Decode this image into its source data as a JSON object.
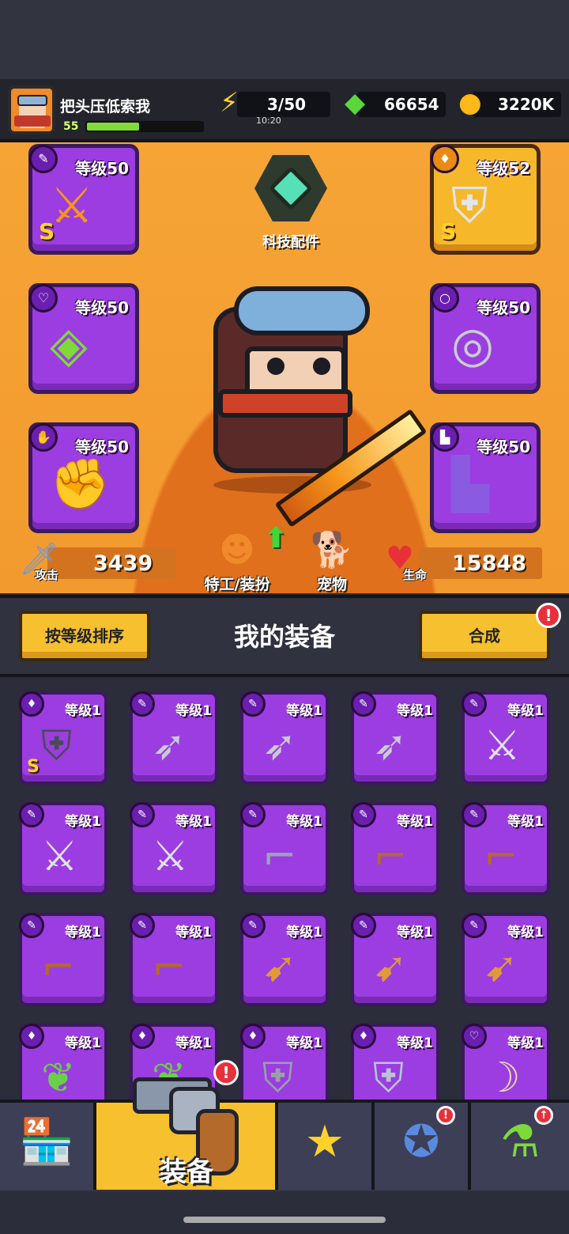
{
  "player": {
    "name": "把头压低索我",
    "level": "55",
    "xp_fraction": 0.45
  },
  "resources": {
    "energy": {
      "value": "3/50",
      "timer": "10:20",
      "icon": "lightning-icon"
    },
    "gems": {
      "value": "66654",
      "icon": "green-gem-icon"
    },
    "coins": {
      "value": "3220K",
      "icon": "gold-coin-icon"
    }
  },
  "equip_slots": {
    "weapon": {
      "level": "等级50",
      "rank": "S",
      "icon": "sword-icon"
    },
    "armor": {
      "level": "等级52",
      "rank": "S",
      "icon": "armor-icon"
    },
    "necklace": {
      "level": "等级50",
      "icon": "necklace-icon"
    },
    "ring": {
      "level": "等级50",
      "icon": "ring-icon"
    },
    "gloves": {
      "level": "等级50",
      "icon": "gauntlet-icon"
    },
    "boots": {
      "level": "等级50",
      "icon": "boot-icon"
    }
  },
  "tech_parts": {
    "label": "科技配件"
  },
  "stats": {
    "attack_label": "攻击",
    "attack": "3439",
    "hp_label": "生命",
    "hp": "15848"
  },
  "buttons": {
    "agent": "特工/装扮",
    "pet": "宠物",
    "sort": "按等级排序",
    "merge": "合成",
    "merge_alert": "!"
  },
  "panel_title": "我的装备",
  "inventory": [
    {
      "level": "等级1",
      "rank": "S",
      "icon": "dark-armor-icon"
    },
    {
      "level": "等级1",
      "icon": "kunai-icon"
    },
    {
      "level": "等级1",
      "icon": "kunai-icon"
    },
    {
      "level": "等级1",
      "icon": "kunai-icon"
    },
    {
      "level": "等级1",
      "icon": "katana-icon"
    },
    {
      "level": "等级1",
      "icon": "katana-icon"
    },
    {
      "level": "等级1",
      "icon": "katana-icon"
    },
    {
      "level": "等级1",
      "icon": "revolver-icon"
    },
    {
      "level": "等级1",
      "icon": "shotgun-icon"
    },
    {
      "level": "等级1",
      "icon": "shotgun-icon"
    },
    {
      "level": "等级1",
      "icon": "shotgun-icon"
    },
    {
      "level": "等级1",
      "icon": "shotgun-icon"
    },
    {
      "level": "等级1",
      "icon": "drill-icon"
    },
    {
      "level": "等级1",
      "icon": "drill-icon"
    },
    {
      "level": "等级1",
      "icon": "drill-icon"
    },
    {
      "level": "等级1",
      "icon": "leaf-armor-icon"
    },
    {
      "level": "等级1",
      "icon": "leaf-armor-icon"
    },
    {
      "level": "等级1",
      "icon": "stone-armor-icon"
    },
    {
      "level": "等级1",
      "icon": "knight-armor-icon"
    },
    {
      "level": "等级1",
      "icon": "fang-necklace-icon"
    }
  ],
  "bottom_nav": {
    "shop": {
      "icon": "shop-icon"
    },
    "equipment": {
      "label": "装备",
      "icon": "revolver-icon",
      "alert": "!"
    },
    "talent": {
      "icon": "star-swords-icon"
    },
    "evolve": {
      "icon": "star-orb-icon",
      "alert": "!"
    },
    "gene": {
      "icon": "dna-tube-icon",
      "badge": "↑"
    }
  },
  "colors": {
    "slot_purple": "#9b3de0",
    "slot_gold": "#f6b82a",
    "stage_orange": "#f29a2e",
    "button_yellow": "#f6c02e",
    "alert_red": "#e8303a"
  }
}
